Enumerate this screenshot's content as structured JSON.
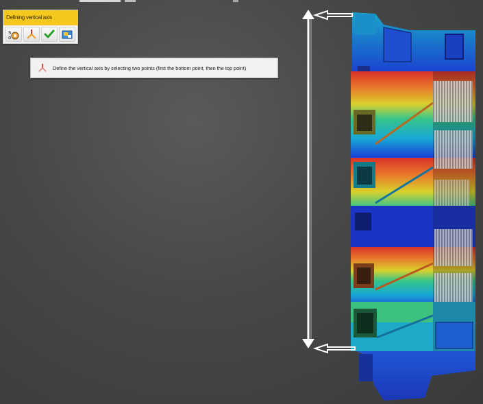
{
  "tool_panel": {
    "title": "Defining vertical axis",
    "buttons": [
      {
        "icon": "pick-points-icon"
      },
      {
        "icon": "axis-icon"
      },
      {
        "icon": "checkmark-icon"
      },
      {
        "icon": "image-export-icon"
      }
    ]
  },
  "message": {
    "icon": "axis-icon",
    "text": "Define the vertical axis by selecting two points (first the bottom point, then the top point)"
  },
  "colors": {
    "title_bar": "#f4c81d",
    "arrow": "#ffffff",
    "background": "#474747"
  }
}
